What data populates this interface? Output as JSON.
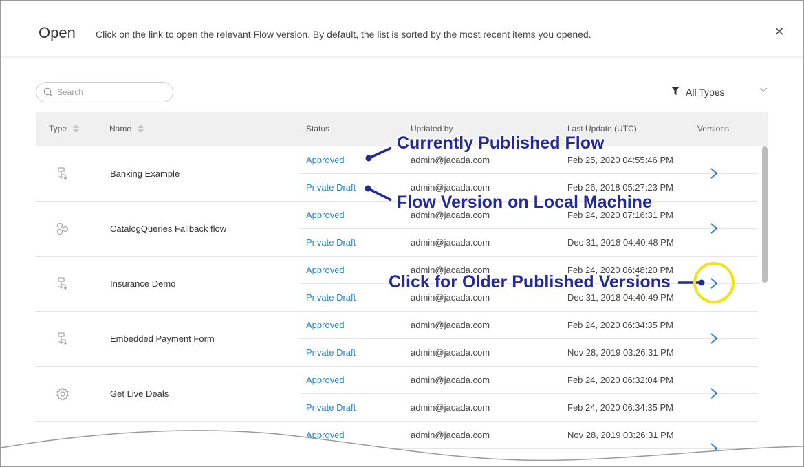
{
  "header": {
    "title": "Open",
    "description": "Click on the link to open the relevant Flow version. By default, the list is sorted by the most recent items you opened.",
    "close_icon": "close-icon"
  },
  "search": {
    "placeholder": "Search",
    "value": "",
    "icon": "search-icon"
  },
  "filter": {
    "label": "All Types",
    "icon": "funnel-icon",
    "chevron_icon": "chevron-down-icon"
  },
  "columns": {
    "type": "Type",
    "name": "Name",
    "status": "Status",
    "updated_by": "Updated by",
    "last_update": "Last Update (UTC)",
    "versions": "Versions"
  },
  "rows": [
    {
      "name": "Banking Example",
      "icon": "flow-icon",
      "versions": [
        {
          "status": "Approved",
          "updated_by": "admin@jacada.com",
          "last_update": "Feb 25, 2020 04:55:46 PM"
        },
        {
          "status": "Private Draft",
          "updated_by": "admin@jacada.com",
          "last_update": "Feb 26, 2018 05:27:23 PM"
        }
      ]
    },
    {
      "name": "CatalogQueries Fallback flow",
      "icon": "fallback-flow-icon",
      "versions": [
        {
          "status": "Approved",
          "updated_by": "admin@jacada.com",
          "last_update": "Feb 24, 2020 07:16:31 PM"
        },
        {
          "status": "Private Draft",
          "updated_by": "admin@jacada.com",
          "last_update": "Dec 31, 2018 04:40:48 PM"
        }
      ]
    },
    {
      "name": "Insurance Demo",
      "icon": "flow-icon",
      "versions": [
        {
          "status": "Approved",
          "updated_by": "admin@jacada.com",
          "last_update": "Feb 24, 2020 06:48:20 PM"
        },
        {
          "status": "Private Draft",
          "updated_by": "admin@jacada.com",
          "last_update": "Dec 31, 2018 04:40:49 PM"
        }
      ]
    },
    {
      "name": "Embedded Payment Form",
      "icon": "flow-icon",
      "versions": [
        {
          "status": "Approved",
          "updated_by": "admin@jacada.com",
          "last_update": "Feb 24, 2020 06:34:35 PM"
        },
        {
          "status": "Private Draft",
          "updated_by": "admin@jacada.com",
          "last_update": "Nov 28, 2019 03:26:31 PM"
        }
      ]
    },
    {
      "name": "Get Live Deals",
      "icon": "gear-icon",
      "versions": [
        {
          "status": "Approved",
          "updated_by": "admin@jacada.com",
          "last_update": "Feb 24, 2020 06:32:04 PM"
        },
        {
          "status": "Private Draft",
          "updated_by": "admin@jacada.com",
          "last_update": "Feb 24, 2020 06:34:35 PM"
        }
      ]
    },
    {
      "name": "",
      "icon": "flow-icon",
      "versions": [
        {
          "status": "Approved",
          "updated_by": "admin@jacada.com",
          "last_update": "Nov 28, 2019 03:26:31 PM"
        },
        {
          "status": "",
          "updated_by": "",
          "last_update": ""
        }
      ]
    }
  ],
  "annotations": {
    "published": "Currently Published Flow",
    "local": "Flow Version on Local Machine",
    "older": "Click for Older Published Versions"
  },
  "colors": {
    "link": "#2e83c6",
    "annotation": "#22299a",
    "highlight": "#f2e21a",
    "header_bg": "#f0f0f0"
  }
}
